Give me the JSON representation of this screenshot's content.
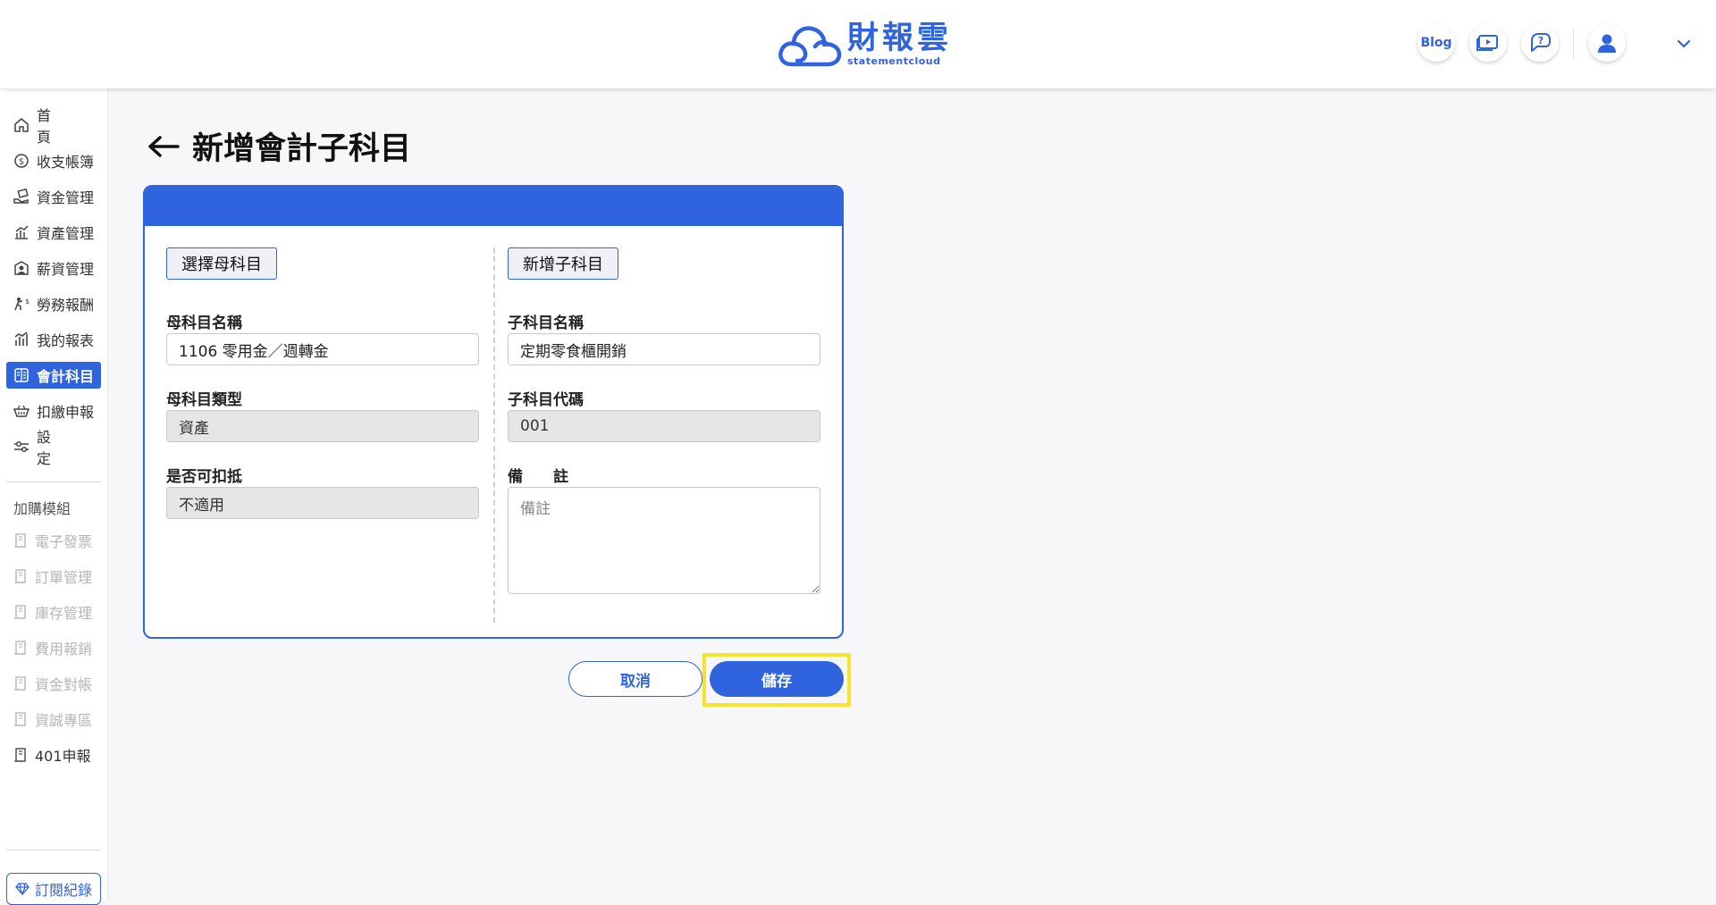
{
  "header": {
    "brand_name": "財報雲",
    "brand_sub": "statementcloud",
    "blog_label": "Blog",
    "buttons": [
      "video-tutorial-icon",
      "help-chat-icon",
      "user-avatar-icon",
      "chevron-down-icon"
    ]
  },
  "sidebar": {
    "items": [
      {
        "label": "首頁",
        "icon": "home-icon"
      },
      {
        "label": "收支帳簿",
        "icon": "coin-icon"
      },
      {
        "label": "資金管理",
        "icon": "money-hand-icon"
      },
      {
        "label": "資產管理",
        "icon": "asset-chart-icon"
      },
      {
        "label": "薪資管理",
        "icon": "salary-icon"
      },
      {
        "label": "勞務報酬",
        "icon": "labor-icon"
      },
      {
        "label": "我的報表",
        "icon": "report-chart-icon"
      },
      {
        "label": "會計科目",
        "icon": "ledger-icon",
        "active": true
      },
      {
        "label": "扣繳申報",
        "icon": "tax-basket-icon"
      },
      {
        "label": "設定",
        "icon": "settings-sliders-icon"
      }
    ],
    "addon_heading": "加購模組",
    "addons": [
      "電子發票",
      "訂單管理",
      "庫存管理",
      "費用報銷",
      "資金對帳",
      "資誠專區",
      "401申報"
    ],
    "subscription_label": "訂閱紀錄"
  },
  "page": {
    "title": "新增會計子科目"
  },
  "form": {
    "parent_tab": "選擇母科目",
    "child_tab": "新增子科目",
    "parent_name_label": "母科目名稱",
    "parent_name_value": "1106 零用金／週轉金",
    "parent_type_label": "母科目類型",
    "parent_type_value": "資產",
    "deductible_label": "是否可扣抵",
    "deductible_value": "不適用",
    "child_name_label": "子科目名稱",
    "child_name_value": "定期零食櫃開銷",
    "child_code_label": "子科目代碼",
    "child_code_value": "001",
    "notes_label": "備　　註",
    "notes_placeholder": "備註"
  },
  "actions": {
    "cancel_label": "取消",
    "save_label": "儲存"
  },
  "colors": {
    "primary": "#2f64de",
    "highlight": "#f7e22c"
  }
}
